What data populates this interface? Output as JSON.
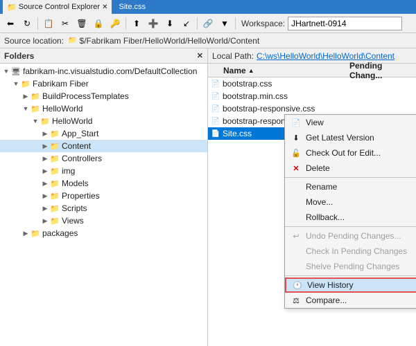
{
  "titleBar": {
    "tabs": [
      {
        "label": "Source Control Explorer",
        "active": true,
        "icon": "📁"
      },
      {
        "label": "Site.css",
        "active": false
      }
    ]
  },
  "toolbar": {
    "buttons": [
      "⬅",
      "↻",
      "📋",
      "✂",
      "🗑",
      "🔒",
      "🔑",
      "⬆",
      "➕",
      "⬇",
      "↙",
      "🔗",
      "▼"
    ],
    "workspaceLabel": "Workspace:",
    "workspaceValue": "JHartnett-0914"
  },
  "sourceLocation": {
    "label": "Source location:",
    "path": "$/Fabrikam Fiber/HelloWorld/HelloWorld/Content"
  },
  "foldersPanel": {
    "header": "Folders",
    "tree": [
      {
        "id": "root",
        "label": "fabrikam-inc.visualstudio.com/DefaultCollection",
        "level": 0,
        "expanded": true,
        "type": "server"
      },
      {
        "id": "fabrikam",
        "label": "Fabrikam Fiber",
        "level": 1,
        "expanded": true,
        "type": "folder"
      },
      {
        "id": "buildprocess",
        "label": "BuildProcessTemplates",
        "level": 2,
        "expanded": false,
        "type": "folder"
      },
      {
        "id": "helloworld",
        "label": "HelloWorld",
        "level": 2,
        "expanded": true,
        "type": "folder"
      },
      {
        "id": "helloworld2",
        "label": "HelloWorld",
        "level": 3,
        "expanded": true,
        "type": "folder"
      },
      {
        "id": "appstart",
        "label": "App_Start",
        "level": 4,
        "expanded": false,
        "type": "folder"
      },
      {
        "id": "content",
        "label": "Content",
        "level": 4,
        "expanded": false,
        "type": "folder",
        "selected": true
      },
      {
        "id": "controllers",
        "label": "Controllers",
        "level": 4,
        "expanded": false,
        "type": "folder"
      },
      {
        "id": "img",
        "label": "img",
        "level": 4,
        "expanded": false,
        "type": "folder"
      },
      {
        "id": "models",
        "label": "Models",
        "level": 4,
        "expanded": false,
        "type": "folder"
      },
      {
        "id": "properties",
        "label": "Properties",
        "level": 4,
        "expanded": false,
        "type": "folder"
      },
      {
        "id": "scripts",
        "label": "Scripts",
        "level": 4,
        "expanded": false,
        "type": "folder"
      },
      {
        "id": "views",
        "label": "Views",
        "level": 4,
        "expanded": false,
        "type": "folder"
      },
      {
        "id": "packages",
        "label": "packages",
        "level": 2,
        "expanded": false,
        "type": "folder"
      }
    ]
  },
  "filesPanel": {
    "header": "Local Path:",
    "localPath": "C:\\ws\\HelloWorld\\HelloWorld\\Content",
    "columns": {
      "name": "Name",
      "pendingChange": "Pending Chang..."
    },
    "files": [
      {
        "name": "bootstrap.css",
        "selected": false
      },
      {
        "name": "bootstrap.min.css",
        "selected": false
      },
      {
        "name": "bootstrap-responsive.css",
        "selected": false
      },
      {
        "name": "bootstrap-responsive.min.css",
        "selected": false
      },
      {
        "name": "Site.css",
        "selected": true
      }
    ]
  },
  "contextMenu": {
    "items": [
      {
        "id": "view",
        "label": "View",
        "icon": "📄",
        "disabled": false
      },
      {
        "id": "getLatest",
        "label": "Get Latest Version",
        "icon": "⬇",
        "disabled": false
      },
      {
        "id": "checkout",
        "label": "Check Out for Edit...",
        "icon": "🔓",
        "disabled": false
      },
      {
        "id": "delete",
        "label": "Delete",
        "icon": "✕",
        "disabled": false,
        "isDelete": true
      },
      {
        "id": "sep1",
        "type": "separator"
      },
      {
        "id": "rename",
        "label": "Rename",
        "icon": "",
        "disabled": false
      },
      {
        "id": "move",
        "label": "Move...",
        "icon": "",
        "disabled": false
      },
      {
        "id": "rollback",
        "label": "Rollback...",
        "icon": "",
        "disabled": false
      },
      {
        "id": "sep2",
        "type": "separator"
      },
      {
        "id": "undo",
        "label": "Undo Pending Changes...",
        "icon": "↩",
        "disabled": true
      },
      {
        "id": "checkin",
        "label": "Check In Pending Changes",
        "icon": "",
        "disabled": true
      },
      {
        "id": "shelve",
        "label": "Shelve Pending Changes",
        "icon": "",
        "disabled": true
      },
      {
        "id": "sep3",
        "type": "separator"
      },
      {
        "id": "viewHistory",
        "label": "View History",
        "icon": "🕐",
        "disabled": false,
        "highlighted": true
      },
      {
        "id": "compare",
        "label": "Compare...",
        "icon": "⚖",
        "disabled": false
      }
    ]
  }
}
